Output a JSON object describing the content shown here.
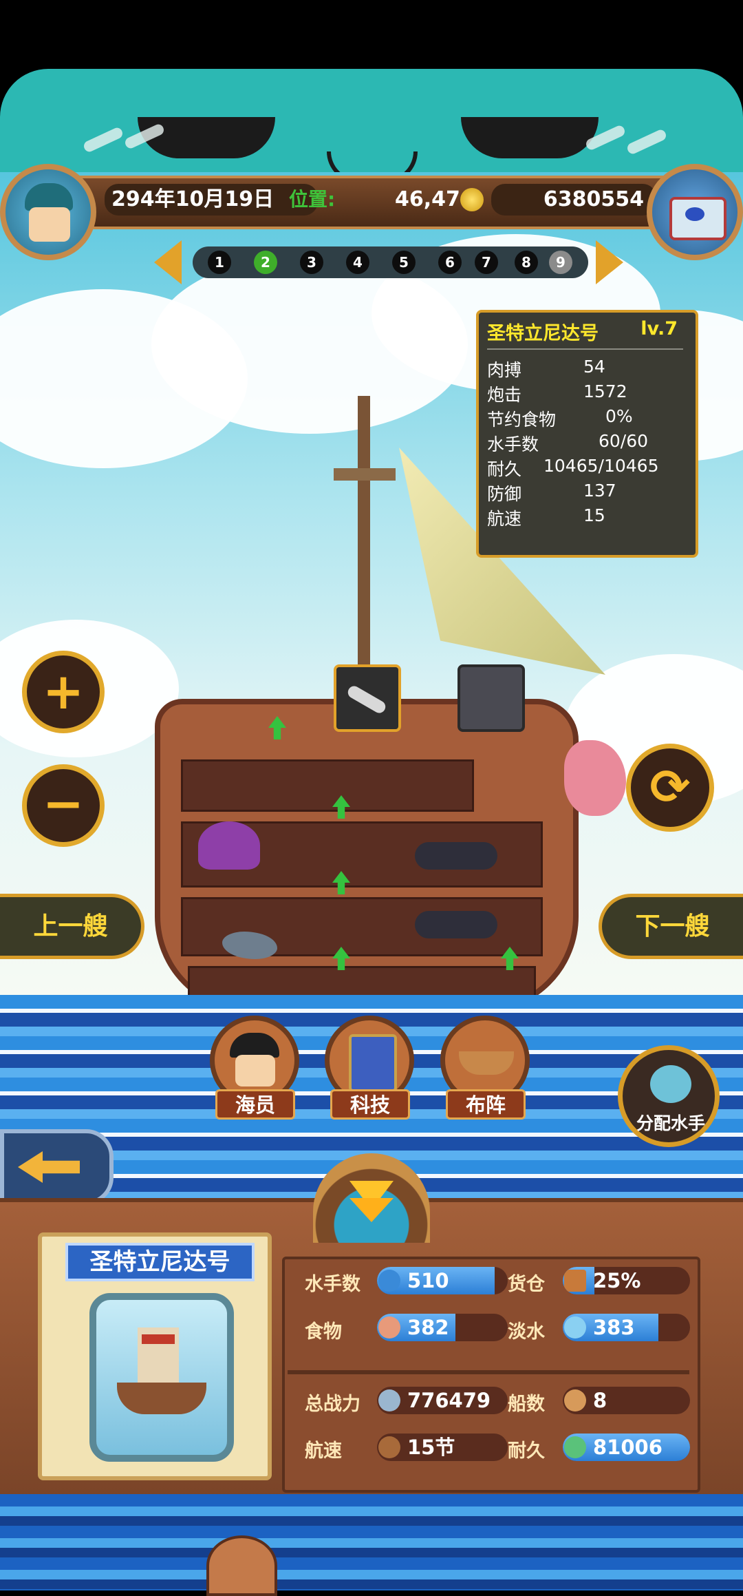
{
  "header": {
    "date": "294年10月19日",
    "position_label": "位置:",
    "position_value": "46,47",
    "gold": "6380554"
  },
  "pager": {
    "pages": [
      "1",
      "2",
      "3",
      "4",
      "5",
      "6",
      "7",
      "8",
      "9"
    ],
    "active": "2"
  },
  "stats": {
    "ship_name": "圣特立尼达号",
    "level": "lv.7",
    "rows": [
      {
        "label": "肉搏",
        "value": "54"
      },
      {
        "label": "炮击",
        "value": "1572"
      },
      {
        "label": "节约食物",
        "value": "0%"
      },
      {
        "label": "水手数",
        "value": "60/60"
      },
      {
        "label": "耐久",
        "value": "10465/10465"
      },
      {
        "label": "防御",
        "value": "137"
      },
      {
        "label": "航速",
        "value": "15"
      }
    ]
  },
  "controls": {
    "zoom_in": "+",
    "zoom_out": "−",
    "prev_ship": "上一艘",
    "next_ship": "下一艘"
  },
  "actions": {
    "crew": "海员",
    "tech": "科技",
    "formation": "布阵",
    "assign_sailors": "分配水手"
  },
  "fleet": {
    "ship_name": "圣特立尼达号",
    "resources": [
      {
        "label": "水手数",
        "value": "510",
        "fill": 0.9
      },
      {
        "label": "货仓",
        "value": "25%",
        "fill": 0.25
      },
      {
        "label": "食物",
        "value": "382",
        "fill": 0.6
      },
      {
        "label": "淡水",
        "value": "383",
        "fill": 0.75
      },
      {
        "label": "总战力",
        "value": "776479",
        "fill": 0
      },
      {
        "label": "船数",
        "value": "8",
        "fill": 0
      },
      {
        "label": "航速",
        "value": "15节",
        "fill": 0
      },
      {
        "label": "耐久",
        "value": "81006",
        "fill": 1.0
      }
    ]
  },
  "colors": {
    "teal": "#2cb8b3",
    "gold": "#d79c28",
    "stat_title": "#ffe82c",
    "active_page": "#3fae2a"
  }
}
